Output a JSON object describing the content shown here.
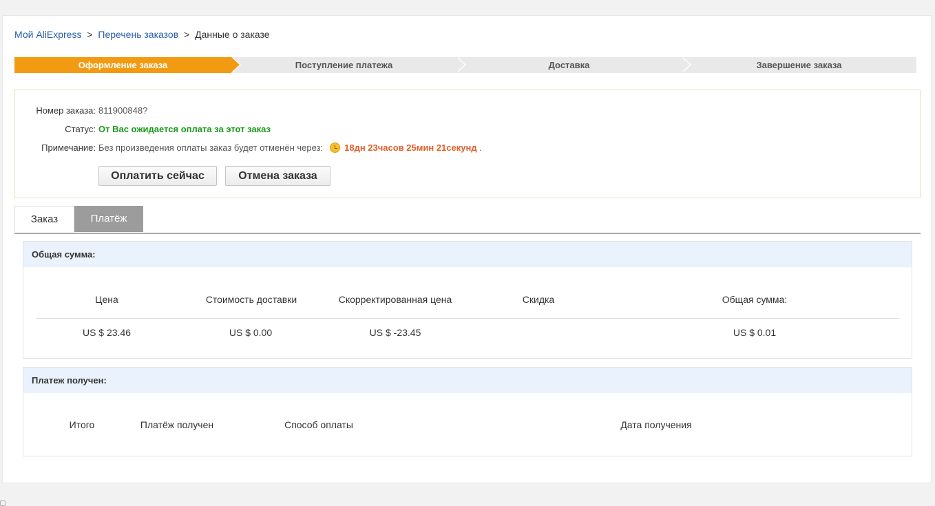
{
  "breadcrumb": {
    "items": [
      "Мой AliExpress",
      "Перечень заказов",
      "Данные о заказе"
    ],
    "separator": ">"
  },
  "steps": [
    "Оформление заказа",
    "Поступление платежа",
    "Доставка",
    "Завершение заказа"
  ],
  "order": {
    "number_label": "Номер заказа:",
    "number_value": "811900848?",
    "status_label": "Статус:",
    "status_value": "От Вас ожидается оплата за этот заказ",
    "note_label": "Примечание:",
    "note_text": "Без произведения оплаты заказ будет отменён через:",
    "timer": "18дн 23часов 25мин 21секунд",
    "timer_suffix": "."
  },
  "buttons": {
    "pay": "Оплатить сейчас",
    "cancel": "Отмена заказа"
  },
  "tabs": [
    "Заказ",
    "Платёж"
  ],
  "total_panel": {
    "title": "Общая сумма:",
    "headers": [
      "Цена",
      "Стоимость доставки",
      "Скорректированная цена",
      "Скидка",
      "Общая сумма:"
    ],
    "values": [
      "US $ 23.46",
      "US $ 0.00",
      "US $ -23.45",
      "",
      "US $ 0.01"
    ]
  },
  "payment_panel": {
    "title": "Платеж получен:",
    "headers": [
      "Итого",
      "Платёж получен",
      "Способ оплаты",
      "Дата получения"
    ]
  },
  "colors": {
    "accent": "#f29b12",
    "status_green": "#1a9a1a",
    "timer_orange": "#e0602b",
    "link_blue": "#2a5ea8"
  }
}
